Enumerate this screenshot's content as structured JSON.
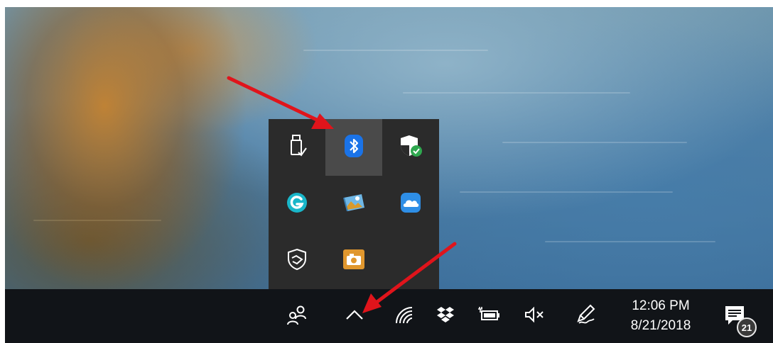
{
  "tray_flyout": {
    "items": [
      {
        "icon": "usb-safely-remove-icon",
        "name": "Safely Remove Hardware"
      },
      {
        "icon": "bluetooth-icon",
        "name": "Bluetooth Devices",
        "hovered": true
      },
      {
        "icon": "windows-security-icon",
        "name": "Windows Security"
      },
      {
        "icon": "grammarly-icon",
        "name": "Grammarly"
      },
      {
        "icon": "photos-app-icon",
        "name": "Photos"
      },
      {
        "icon": "onedrive-icon",
        "name": "OneDrive"
      },
      {
        "icon": "defender-shield-icon",
        "name": "Windows Defender"
      },
      {
        "icon": "screenshot-camera-icon",
        "name": "Screenshot tool"
      }
    ]
  },
  "taskbar": {
    "icons": [
      "people-icon",
      "show-hidden-icons-chevron",
      "wifi-icon",
      "dropbox-icon",
      "battery-icon",
      "volume-muted-icon",
      "pen-workspace-icon"
    ],
    "clock": {
      "time": "12:06 PM",
      "date": "8/21/2018"
    },
    "notifications": {
      "count": "21",
      "icon": "action-center-icon"
    }
  },
  "colors": {
    "taskbar": "#111418",
    "flyout": "#2b2b2b",
    "flyout_hover": "#4a4a4a",
    "bluetooth_blue": "#1a73e8",
    "annotation_arrow": "#e0141b"
  }
}
